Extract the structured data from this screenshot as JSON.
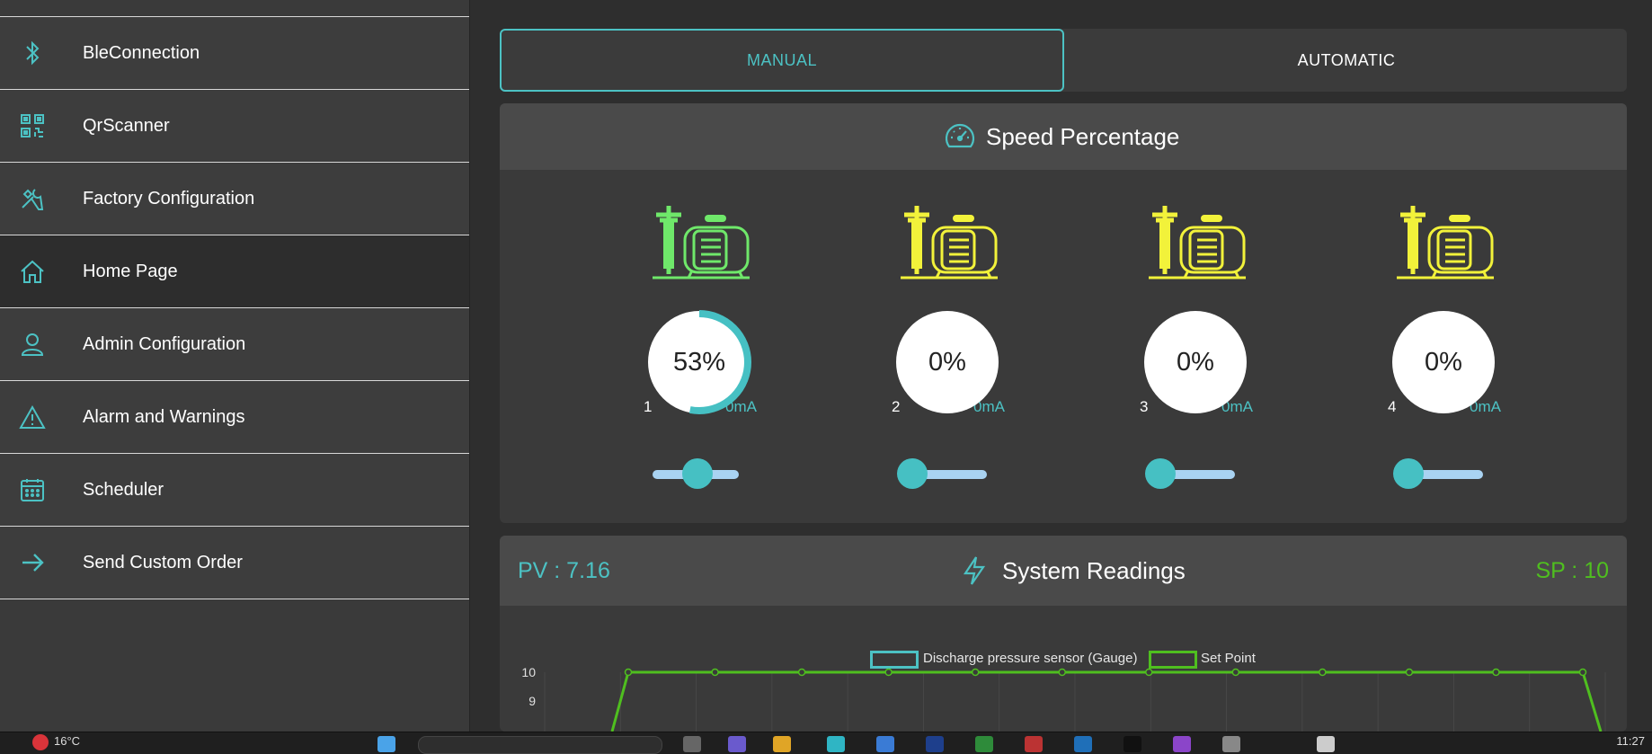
{
  "sidebar": {
    "items": [
      {
        "label": "BleConnection",
        "icon": "bluetooth-icon"
      },
      {
        "label": "QrScanner",
        "icon": "qr-code-icon"
      },
      {
        "label": "Factory Configuration",
        "icon": "tools-icon"
      },
      {
        "label": "Home Page",
        "icon": "home-icon",
        "active": true
      },
      {
        "label": "Admin Configuration",
        "icon": "user-icon"
      },
      {
        "label": "Alarm and Warnings",
        "icon": "warning-icon"
      },
      {
        "label": "Scheduler",
        "icon": "calendar-icon"
      },
      {
        "label": "Send Custom Order",
        "icon": "arrow-right-icon"
      }
    ]
  },
  "mode": {
    "manual_label": "MANUAL",
    "automatic_label": "AUTOMATIC",
    "selected": "MANUAL"
  },
  "speed_panel": {
    "title": "Speed Percentage",
    "icon": "speedometer-icon",
    "pumps": [
      {
        "number": "1",
        "current": "0mA",
        "percent_label": "53%",
        "percent": 53,
        "slider": 0.53,
        "color": "#6fe86a"
      },
      {
        "number": "2",
        "current": "0mA",
        "percent_label": "0%",
        "percent": 0,
        "slider": 0.0,
        "color": "#f2f23a"
      },
      {
        "number": "3",
        "current": "0mA",
        "percent_label": "0%",
        "percent": 0,
        "slider": 0.0,
        "color": "#f2f23a"
      },
      {
        "number": "4",
        "current": "0mA",
        "percent_label": "0%",
        "percent": 0,
        "slider": 0.0,
        "color": "#f2f23a"
      }
    ]
  },
  "readings_panel": {
    "title": "System Readings",
    "icon": "lightning-icon",
    "pv_label": "PV : 7.16",
    "sp_label": "SP : 10"
  },
  "colors": {
    "accent": "#4cc2c4",
    "setpoint": "#4fbf1f"
  },
  "chart_data": {
    "type": "line",
    "legend": [
      "Discharge pressure sensor (Gauge)",
      "Set Point"
    ],
    "y_ticks": [
      "10",
      "9"
    ],
    "series": [
      {
        "name": "Discharge pressure sensor (Gauge)",
        "color": "#4cc2c4",
        "values": []
      },
      {
        "name": "Set Point",
        "color": "#4fbf1f",
        "values": [
          10,
          10,
          10,
          10,
          10,
          10,
          10,
          10,
          10,
          10,
          10,
          10
        ]
      }
    ]
  },
  "taskbar": {
    "weather": "16°C",
    "clock": "11:27"
  }
}
